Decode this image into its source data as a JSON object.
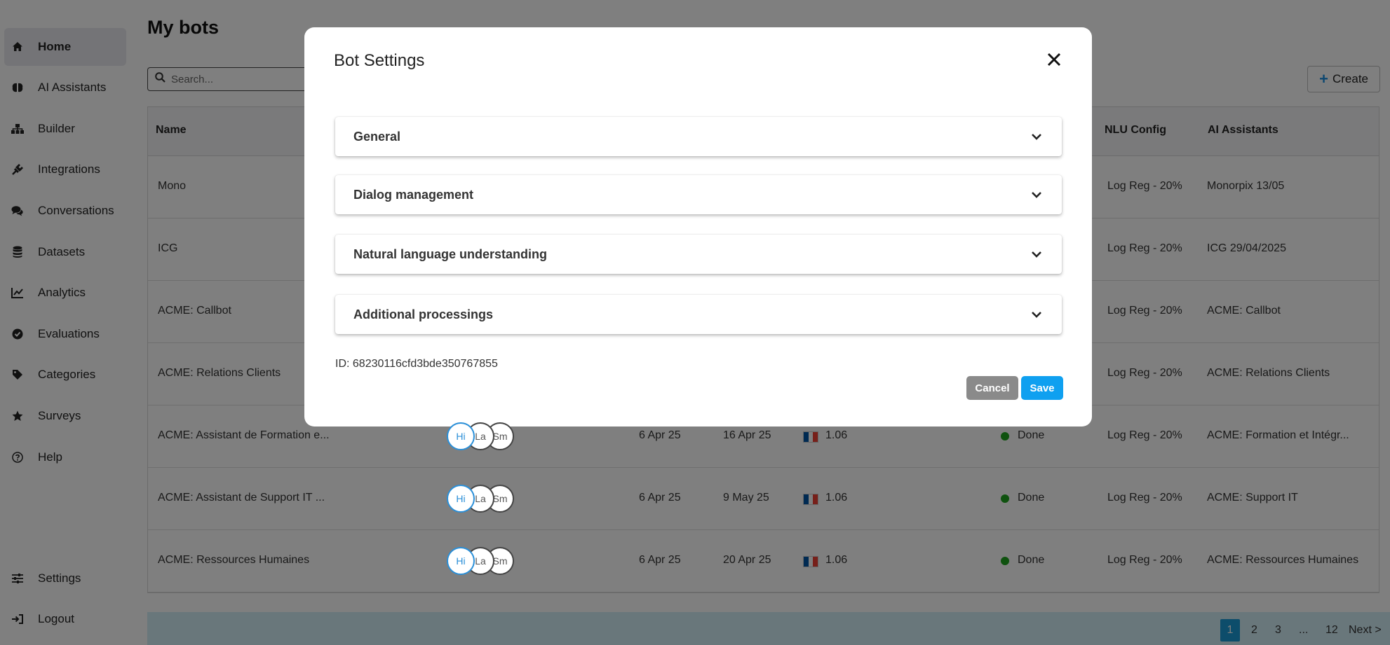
{
  "sidebar": {
    "items": [
      {
        "label": "Home",
        "icon": "home-icon"
      },
      {
        "label": "AI Assistants",
        "icon": "brain-icon"
      },
      {
        "label": "Builder",
        "icon": "sitemap-icon"
      },
      {
        "label": "Integrations",
        "icon": "plug-icon"
      },
      {
        "label": "Conversations",
        "icon": "chat-icon"
      },
      {
        "label": "Datasets",
        "icon": "database-icon"
      },
      {
        "label": "Analytics",
        "icon": "chart-line-icon"
      },
      {
        "label": "Evaluations",
        "icon": "check-circle-icon"
      },
      {
        "label": "Categories",
        "icon": "tag-icon"
      },
      {
        "label": "Surveys",
        "icon": "star-icon"
      },
      {
        "label": "Help",
        "icon": "question-circle-icon"
      }
    ],
    "bottom": [
      {
        "label": "Settings",
        "icon": "sliders-icon"
      },
      {
        "label": "Logout",
        "icon": "sign-out-icon"
      }
    ]
  },
  "main": {
    "title": "My bots",
    "search_placeholder": "Search...",
    "create_label": "Create",
    "columns": {
      "name": "Name",
      "nlu": "NLU Config",
      "assistants": "AI Assistants"
    },
    "rows": [
      {
        "name": "Mono",
        "nlu": "Log Reg - 20%",
        "assistant": "Monorpix 13/05"
      },
      {
        "name": "ICG",
        "nlu": "Log Reg - 20%",
        "assistant": "ICG 29/04/2025"
      },
      {
        "name": "ACME: Callbot",
        "nlu": "Log Reg - 20%",
        "assistant": "ACME: Callbot"
      },
      {
        "name": "ACME: Relations Clients",
        "nlu": "Log Reg - 20%",
        "assistant": "ACME: Relations Clients"
      },
      {
        "name": "ACME: Assistant de Formation e...",
        "avatars": [
          "Hi",
          "La",
          "Sm"
        ],
        "created": "6 Apr 25",
        "updated": "16 Apr 25",
        "version": "1.06",
        "status": "Done",
        "nlu": "Log Reg - 20%",
        "assistant": "ACME: Formation et Intégr..."
      },
      {
        "name": "ACME: Assistant de Support IT ...",
        "avatars": [
          "Hi",
          "La",
          "Sm"
        ],
        "created": "6 Apr 25",
        "updated": "9 May 25",
        "version": "1.06",
        "status": "Done",
        "nlu": "Log Reg - 20%",
        "assistant": "ACME: Support IT"
      },
      {
        "name": "ACME: Ressources Humaines",
        "avatars": [
          "Hi",
          "La",
          "Sm"
        ],
        "created": "6 Apr 25",
        "updated": "20 Apr 25",
        "version": "1.06",
        "status": "Done",
        "nlu": "Log Reg - 20%",
        "assistant": "ACME: Ressources Humaines"
      }
    ],
    "pagination": {
      "pages": [
        "1",
        "2",
        "3",
        "...",
        "12"
      ],
      "next": "Next >",
      "current": "1"
    }
  },
  "modal": {
    "title": "Bot Settings",
    "sections": [
      "General",
      "Dialog management",
      "Natural language understanding",
      "Additional processings"
    ],
    "id_text": "ID: 68230116cfd3bde350767855",
    "cancel_label": "Cancel",
    "save_label": "Save"
  },
  "colors": {
    "accent": "#0fa0f0",
    "cancel": "#8a8a8a",
    "status_done": "#1ea51e",
    "pager_bg": "#d3eef7"
  }
}
